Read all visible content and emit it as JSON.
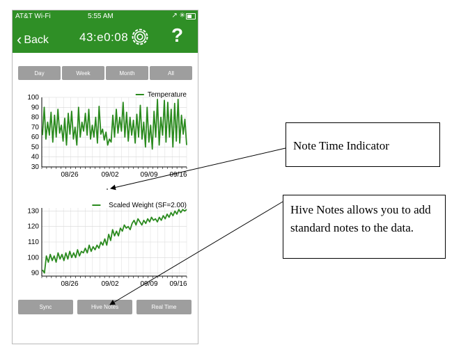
{
  "status_bar": {
    "carrier": "AT&T Wi-Fi",
    "time": "5:55 AM"
  },
  "nav": {
    "back_label": "Back",
    "title": "43:e0:08",
    "help_label": "?"
  },
  "range_buttons": [
    "Day",
    "Week",
    "Month",
    "All"
  ],
  "bottom_buttons": [
    "Sync",
    "Hive Notes",
    "Real Time"
  ],
  "colors": {
    "header_green": "#2f8f26",
    "series_green": "#2a8a1e",
    "button_gray": "#9e9e9e"
  },
  "chart_data": [
    {
      "type": "line",
      "series": [
        {
          "name": "Temperature"
        }
      ],
      "y_ticks": [
        "100",
        "90",
        "80",
        "70",
        "60",
        "50",
        "40",
        "30"
      ],
      "x_ticks": [
        "08/26",
        "09/02",
        "09/09",
        "09/16"
      ],
      "ylim": [
        30,
        100
      ],
      "x_range_days": [
        0,
        30
      ],
      "values": [
        62,
        90,
        58,
        75,
        62,
        85,
        55,
        82,
        60,
        88,
        64,
        72,
        56,
        79,
        52,
        84,
        63,
        86,
        58,
        70,
        52,
        90,
        60,
        75,
        66,
        84,
        62,
        88,
        58,
        72,
        60,
        80,
        54,
        91,
        63,
        68,
        57,
        65,
        52,
        58,
        55,
        82,
        60,
        88,
        64,
        80,
        66,
        95,
        60,
        85,
        56,
        80,
        62,
        77,
        54,
        83,
        60,
        92,
        58,
        75,
        50,
        90,
        55,
        72,
        48,
        86,
        60,
        98,
        52,
        80,
        62,
        97,
        55,
        95,
        60,
        88,
        50,
        94,
        56,
        98,
        54,
        82,
        63,
        78,
        52
      ],
      "grid": true,
      "legend": "top-right"
    },
    {
      "type": "line",
      "series": [
        {
          "name": "Scaled Weight (SF=2.00)"
        }
      ],
      "y_ticks": [
        "130",
        "120",
        "110",
        "100",
        "90"
      ],
      "x_ticks": [
        "08/26",
        "09/02",
        "09/09",
        "09/16"
      ],
      "ylim": [
        88,
        132
      ],
      "x_range_days": [
        0,
        30
      ],
      "values": [
        92,
        90,
        101,
        97,
        102,
        98,
        101,
        97,
        103,
        99,
        102,
        98,
        103,
        99,
        104,
        100,
        103,
        100,
        105,
        101,
        104,
        103,
        106,
        103,
        108,
        104,
        107,
        105,
        108,
        106,
        110,
        108,
        112,
        108,
        115,
        111,
        118,
        114,
        117,
        114,
        119,
        117,
        121,
        119,
        120,
        118,
        122,
        124,
        121,
        125,
        123,
        121,
        124,
        122,
        125,
        123,
        126,
        124,
        125,
        123,
        126,
        124,
        127,
        125,
        128,
        126,
        129,
        127,
        130,
        128,
        131,
        129,
        131,
        130,
        131
      ],
      "grid": true,
      "legend": "top-right"
    }
  ],
  "callouts": {
    "note_time": "Note Time Indicator",
    "hive_notes": "Hive Notes allows you to add standard notes to the data."
  }
}
